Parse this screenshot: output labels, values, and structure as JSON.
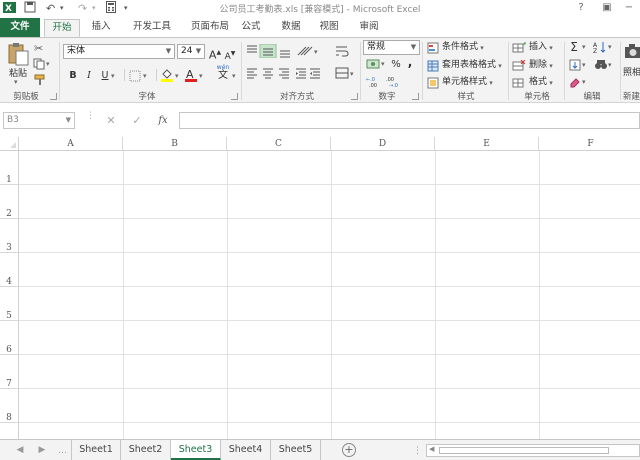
{
  "window": {
    "title": "公司员工考勤表.xls  [兼容模式] - Microsoft Excel",
    "minimize": "−",
    "restore": "▭",
    "help": "?"
  },
  "tabs": [
    {
      "label": "文件"
    },
    {
      "label": "开始"
    },
    {
      "label": "插入"
    },
    {
      "label": "开发工具"
    },
    {
      "label": "页面布局"
    },
    {
      "label": "公式"
    },
    {
      "label": "数据"
    },
    {
      "label": "视图"
    },
    {
      "label": "审阅"
    }
  ],
  "ribbon": {
    "clipboard": {
      "paste": "粘贴",
      "group": "剪贴板"
    },
    "font": {
      "name": "宋体",
      "size": "24",
      "bold": "B",
      "italic": "I",
      "underline": "U",
      "grow": "A",
      "shrink": "A",
      "group": "字体",
      "wen": "wén",
      "wen_char": "文"
    },
    "align": {
      "group": "对齐方式"
    },
    "number": {
      "format": "常规",
      "percent": "%",
      "comma": ",",
      "group": "数字"
    },
    "styles": {
      "cond": "条件格式",
      "table": "套用表格格式",
      "cell": "单元格样式",
      "group": "样式"
    },
    "cells": {
      "insert": "插入",
      "delete": "删除",
      "format": "格式",
      "group": "单元格"
    },
    "editing": {
      "sum": "Σ",
      "group": "编辑"
    },
    "new": {
      "photo": "照相",
      "group": "新建"
    }
  },
  "formula": {
    "namebox": "B3",
    "cancel": "✕",
    "enter": "✓",
    "fx": "fx",
    "value": ""
  },
  "columns": [
    "A",
    "B",
    "C",
    "D",
    "E",
    "F"
  ],
  "rows": [
    "1",
    "2",
    "3",
    "4",
    "5",
    "6",
    "7",
    "8"
  ],
  "sheets": [
    "Sheet1",
    "Sheet2",
    "Sheet3",
    "Sheet4",
    "Sheet5"
  ],
  "active_sheet": "Sheet3",
  "add_sheet": "+",
  "colors": {
    "accent": "#217346"
  }
}
